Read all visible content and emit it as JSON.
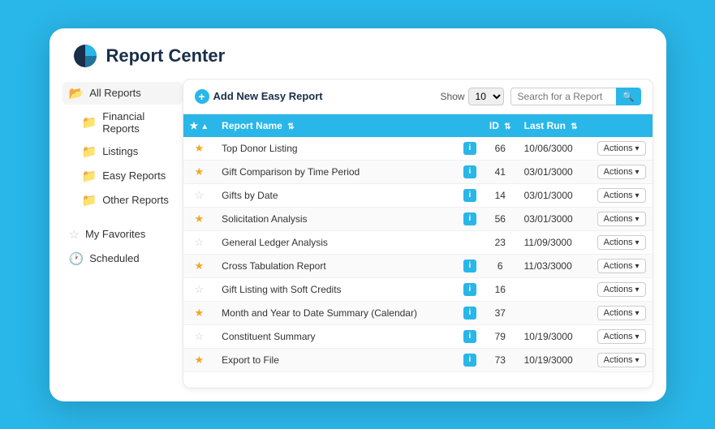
{
  "app": {
    "title": "Report Center"
  },
  "sidebar": {
    "all_reports_label": "All Reports",
    "financial_reports_label": "Financial Reports",
    "listings_label": "Listings",
    "easy_reports_label": "Easy Reports",
    "other_reports_label": "Other Reports",
    "my_favorites_label": "My  Favorites",
    "scheduled_label": "Scheduled"
  },
  "toolbar": {
    "add_label": "Add New Easy Report",
    "show_label": "Show",
    "show_value": "10",
    "search_placeholder": "Search for a Report",
    "search_btn_icon": "🔍"
  },
  "table": {
    "columns": [
      {
        "id": "star",
        "label": "★"
      },
      {
        "id": "name",
        "label": "Report Name"
      },
      {
        "id": "info",
        "label": ""
      },
      {
        "id": "id",
        "label": "ID"
      },
      {
        "id": "lastrun",
        "label": "Last Run"
      }
    ],
    "rows": [
      {
        "star": true,
        "name": "Top Donor Listing",
        "id": "66",
        "lastrun": "10/06/3000",
        "hasInfo": true
      },
      {
        "star": true,
        "name": "Gift Comparison by Time Period",
        "id": "41",
        "lastrun": "03/01/3000",
        "hasInfo": true
      },
      {
        "star": false,
        "name": "Gifts by Date",
        "id": "14",
        "lastrun": "03/01/3000",
        "hasInfo": true
      },
      {
        "star": true,
        "name": "Solicitation Analysis",
        "id": "56",
        "lastrun": "03/01/3000",
        "hasInfo": true
      },
      {
        "star": false,
        "name": "General Ledger Analysis",
        "id": "23",
        "lastrun": "11/09/3000",
        "hasInfo": false
      },
      {
        "star": true,
        "name": "Cross Tabulation Report",
        "id": "6",
        "lastrun": "11/03/3000",
        "hasInfo": true
      },
      {
        "star": false,
        "name": "Gift Listing with Soft Credits",
        "id": "16",
        "lastrun": "",
        "hasInfo": true
      },
      {
        "star": true,
        "name": "Month and Year to Date Summary (Calendar)",
        "id": "37",
        "lastrun": "",
        "hasInfo": true
      },
      {
        "star": false,
        "name": "Constituent Summary",
        "id": "79",
        "lastrun": "10/19/3000",
        "hasInfo": true
      },
      {
        "star": true,
        "name": "Export to File",
        "id": "73",
        "lastrun": "10/19/3000",
        "hasInfo": true
      }
    ],
    "actions_label": "Actions"
  }
}
